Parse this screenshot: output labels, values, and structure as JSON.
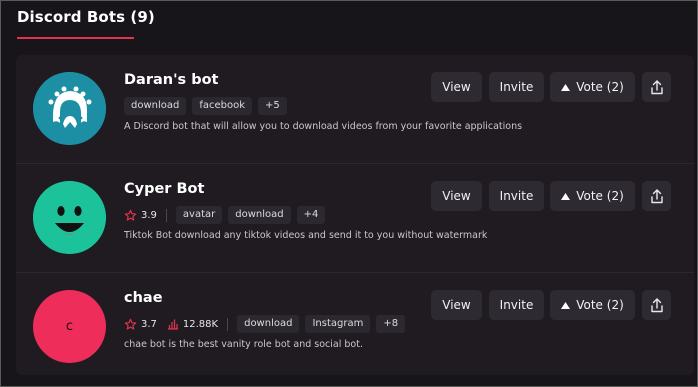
{
  "section": {
    "title": "Discord Bots (9)"
  },
  "bots": [
    {
      "name": "Daran's bot",
      "tags": [
        "download",
        "facebook",
        "+5"
      ],
      "description": "A Discord bot that will allow you to download videos from your favorite applications",
      "avatar_color": "#1d8fa5",
      "avatar_icon": "octopus-logo-icon",
      "buttons": {
        "view": "View",
        "invite": "Invite",
        "vote": "Vote (2)"
      }
    },
    {
      "name": "Cyper Bot",
      "rating": "3.9",
      "tags": [
        "avatar",
        "download",
        "+4"
      ],
      "description": "Tiktok Bot download any tiktok videos and send it to you without watermark",
      "avatar_color": "#1cc29a",
      "avatar_icon": "smiley-face-icon",
      "buttons": {
        "view": "View",
        "invite": "Invite",
        "vote": "Vote (2)"
      }
    },
    {
      "name": "chae",
      "rating": "3.7",
      "servers": "12.88K",
      "avatar_letter": "c",
      "tags": [
        "download",
        "Instagram",
        "+8"
      ],
      "description": "chae bot is the best vanity role bot and social bot.",
      "avatar_color": "#ee2d5a",
      "buttons": {
        "view": "View",
        "invite": "Invite",
        "vote": "Vote (2)"
      }
    }
  ],
  "colors": {
    "accent": "#e0334f",
    "star": "#e0334f"
  }
}
